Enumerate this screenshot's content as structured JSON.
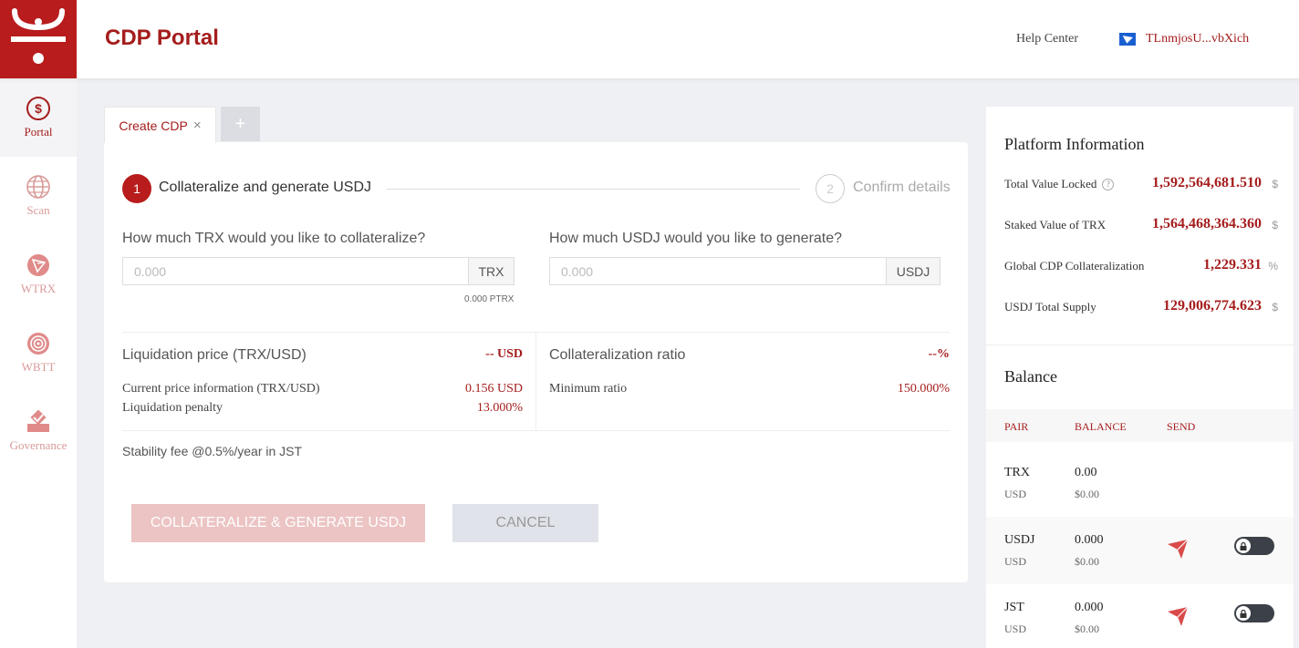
{
  "header": {
    "title": "CDP Portal",
    "help_center": "Help Center",
    "wallet_address": "TLnmjosU...vbXich"
  },
  "sidebar": {
    "items": [
      {
        "label": "Portal",
        "icon": "dollar-icon",
        "active": true
      },
      {
        "label": "Scan",
        "icon": "globe-icon"
      },
      {
        "label": "WTRX",
        "icon": "tron-icon"
      },
      {
        "label": "WBTT",
        "icon": "bittorrent-icon"
      },
      {
        "label": "Governance",
        "icon": "ballot-icon"
      }
    ]
  },
  "tabs": {
    "create_label": "Create CDP",
    "close_glyph": "×",
    "add_glyph": "+"
  },
  "steps": {
    "step1_number": "1",
    "step1_label": "Collateralize and generate USDJ",
    "step2_number": "2",
    "step2_label": "Confirm details"
  },
  "form": {
    "trx_question": "How much TRX would you like to collateralize?",
    "trx_placeholder": "0.000",
    "trx_unit": "TRX",
    "ptrx_note": "0.000 PTRX",
    "usdj_question": "How much USDJ would you like to generate?",
    "usdj_placeholder": "0.000",
    "usdj_unit": "USDJ"
  },
  "liquidation": {
    "title": "Liquidation price (TRX/USD)",
    "value": "-- USD",
    "current_price_label": "Current price information (TRX/USD)",
    "current_price_value": "0.156 USD",
    "penalty_label": "Liquidation penalty",
    "penalty_value": "13.000%"
  },
  "collateralization": {
    "title": "Collateralization ratio",
    "value": "--%",
    "min_label": "Minimum ratio",
    "min_value": "150.000%"
  },
  "stability_fee": "Stability fee @0.5%/year in JST",
  "buttons": {
    "primary": "COLLATERALIZE & GENERATE USDJ",
    "cancel": "CANCEL"
  },
  "platform": {
    "title": "Platform Information",
    "rows": [
      {
        "label": "Total Value Locked",
        "value": "1,592,564,681.510",
        "unit": "$",
        "help": "?"
      },
      {
        "label": "Staked Value of TRX",
        "value": "1,564,468,364.360",
        "unit": "$"
      },
      {
        "label": "Global CDP Collateralization",
        "value": "1,229.331",
        "unit": "%"
      },
      {
        "label": "USDJ Total Supply",
        "value": "129,006,774.623",
        "unit": "$"
      }
    ]
  },
  "balance": {
    "title": "Balance",
    "headers": {
      "pair": "PAIR",
      "balance": "BALANCE",
      "send": "SEND"
    },
    "rows": [
      {
        "symbol": "TRX",
        "usd_label": "USD",
        "amount": "0.00",
        "usd_value": "$0.00"
      },
      {
        "symbol": "USDJ",
        "usd_label": "USD",
        "amount": "0.000",
        "usd_value": "$0.00"
      },
      {
        "symbol": "JST",
        "usd_label": "USD",
        "amount": "0.000",
        "usd_value": "$0.00"
      }
    ]
  },
  "colors": {
    "brand": "#b81c1c",
    "accent_text": "#a51d1d",
    "primary_button_disabled": "#ecc4c4",
    "background": "#eff0f3"
  }
}
